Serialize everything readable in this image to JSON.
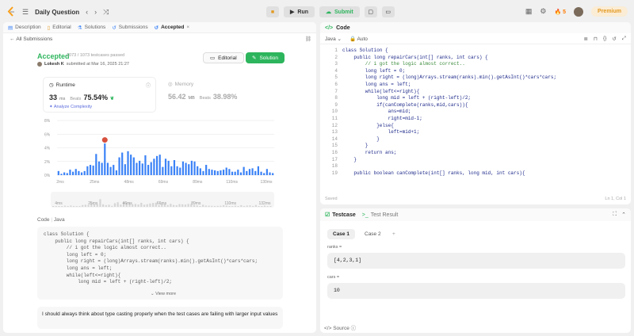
{
  "topbar": {
    "title": "Daily Question",
    "run_label": "Run",
    "submit_label": "Submit",
    "streak": "5",
    "premium_label": "Premium"
  },
  "left": {
    "tabs": [
      {
        "label": "Description"
      },
      {
        "label": "Editorial"
      },
      {
        "label": "Solutions"
      },
      {
        "label": "Submissions"
      },
      {
        "label": "Accepted"
      }
    ],
    "back_label": "All Submissions",
    "status": "Accepted",
    "passed": "1073 / 1073 testcases passed",
    "user": "Lokesh K",
    "submitted_text": "submitted at Mar 16, 2025 21:27",
    "editorial_btn": "Editorial",
    "solution_btn": "Solution",
    "runtime": {
      "label": "Runtime",
      "value": "33",
      "unit": "ms",
      "beats_label": "Beats",
      "beats_value": "75.54%",
      "analyze": "Analyze Complexity"
    },
    "memory": {
      "label": "Memory",
      "value": "56.42",
      "unit": "MB",
      "beats_label": "Beats",
      "beats_value": "38.98%"
    },
    "code_title": "Code",
    "code_lang": "Java",
    "code_lines": [
      "class Solution {",
      "    public long repairCars(int[] ranks, int cars) {",
      "        // i got the logic almost correct..",
      "        long left = 0;",
      "        long right = (long)Arrays.stream(ranks).min().getAsInt()*cars*cars;",
      "        long ans = left;",
      "        while(left<=right){",
      "            long mid = left + (right-left)/2;"
    ],
    "view_more": "View more",
    "note": "I should always think about type casting properly when the test cases are failing with larger input values"
  },
  "chart_data": {
    "type": "bar",
    "yticks": [
      "8%",
      "6%",
      "4%",
      "2%",
      "0%"
    ],
    "ylim": [
      0,
      8
    ],
    "xticks": [
      "2ms",
      "25ms",
      "48ms",
      "69ms",
      "89ms",
      "110ms",
      "130ms"
    ],
    "range_ticks": [
      "4ms",
      "25ms",
      "46ms",
      "66ms",
      "89ms",
      "110ms",
      "132ms"
    ],
    "values": [
      0.6,
      0.2,
      0.4,
      0.3,
      0.8,
      0.5,
      0.9,
      0.6,
      0.4,
      0.6,
      1.3,
      1.5,
      1.4,
      3.1,
      2.0,
      1.8,
      5.5,
      1.8,
      1.2,
      1.5,
      0.7,
      2.6,
      3.3,
      1.6,
      3.5,
      3.0,
      2.6,
      1.8,
      2.1,
      1.7,
      2.9,
      1.5,
      1.9,
      2.4,
      2.8,
      3.0,
      1.2,
      2.4,
      2.1,
      1.3,
      2.2,
      1.3,
      1.1,
      2.0,
      1.8,
      1.6,
      2.1,
      2.0,
      1.3,
      1.0,
      0.6,
      1.5,
      0.9,
      0.8,
      0.7,
      0.6,
      0.7,
      0.8,
      1.1,
      0.9,
      0.5,
      0.5,
      0.8,
      0.4,
      1.2,
      0.6,
      0.9,
      1.0,
      0.6,
      1.3,
      0.5,
      0.3,
      0.9,
      0.4,
      0.3
    ],
    "highlight_index": 16,
    "colors": {
      "bar": "#3b82f6",
      "highlight": "#d7513e",
      "grid": "#e5e5e5",
      "range_bar": "#d6d6d6"
    }
  },
  "right": {
    "code_header": "Code",
    "language": "Java",
    "mode": "Auto",
    "editor_lines": [
      "class Solution {",
      "    public long repairCars(int[] ranks, int cars) {",
      "        // i got the logic almost correct..",
      "        long left = 0;",
      "        long right = (long)Arrays.stream(ranks).min().getAsInt()*cars*cars;",
      "        long ans = left;",
      "        while(left<=right){",
      "            long mid = left + (right-left)/2;",
      "            if(canComplete(ranks,mid,cars)){",
      "                ans=mid;",
      "                right=mid-1;",
      "            }else{",
      "                left=mid+1;",
      "            }",
      "        }",
      "        return ans;",
      "    }",
      "",
      "    public boolean canComplete(int[] ranks, long mid, int cars){"
    ],
    "saved": "Saved",
    "position": "Ln 1, Col 1",
    "testcase_label": "Testcase",
    "testresult_label": "Test Result",
    "case1": "Case 1",
    "case2": "Case 2",
    "add": "+",
    "inputs": [
      {
        "name": "ranks =",
        "value": "[4,2,3,1]"
      },
      {
        "name": "cars =",
        "value": "10"
      }
    ],
    "source": "Source"
  }
}
